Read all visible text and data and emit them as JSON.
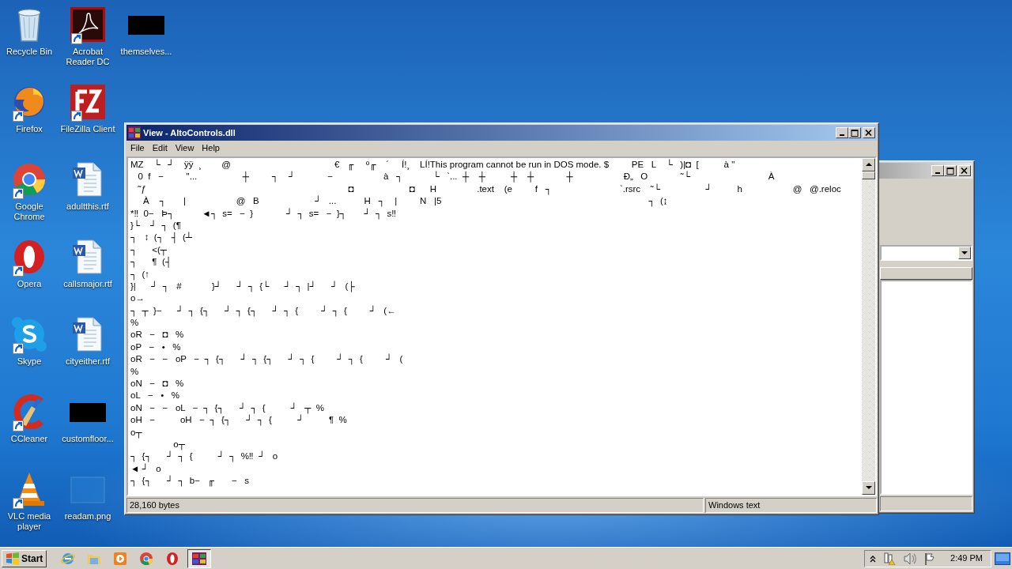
{
  "desktop_icons": [
    {
      "label": "Recycle Bin",
      "kind": "recycle",
      "shortcut": false
    },
    {
      "label": "Firefox",
      "kind": "firefox",
      "shortcut": true
    },
    {
      "label": "Google Chrome",
      "kind": "chrome",
      "shortcut": true
    },
    {
      "label": "Opera",
      "kind": "opera",
      "shortcut": true
    },
    {
      "label": "Skype",
      "kind": "skype",
      "shortcut": true
    },
    {
      "label": "CCleaner",
      "kind": "ccleaner",
      "shortcut": true
    },
    {
      "label": "VLC media player",
      "kind": "vlc",
      "shortcut": true
    },
    {
      "label": "Acrobat Reader DC",
      "kind": "acrobat",
      "shortcut": true
    },
    {
      "label": "FileZilla Client",
      "kind": "filezilla",
      "shortcut": true
    },
    {
      "label": "adultthis.rtf",
      "kind": "word",
      "shortcut": false
    },
    {
      "label": "callsmajor.rtf",
      "kind": "word",
      "shortcut": false
    },
    {
      "label": "cityeither.rtf",
      "kind": "word",
      "shortcut": false
    },
    {
      "label": "customfloor...",
      "kind": "redacted",
      "shortcut": false
    },
    {
      "label": "readam.png",
      "kind": "image",
      "shortcut": false
    },
    {
      "label": "themselves...",
      "kind": "redacted",
      "shortcut": false
    }
  ],
  "viewer_window": {
    "title": "View - AltoControls.dll",
    "menu": [
      "File",
      "Edit",
      "View",
      "Help"
    ],
    "lines": [
      "MZ    └   ┘    ÿÿ  ¸        @                                         €   ╓     º╓    ´     Í!¸    LÍ!This program cannot be run in DOS mode. $         PE   L    └   )|◘  [          à \"",
      "   0  f   −         \"...                  ┼         ┐    ┘             −                    à   ┐            └   `...  ┼    ┼          ┼    ┼             ┼                    Ð„   O             ˜└                               À",
      "   ˜ƒ                                                                                ◘                      ◘      H                .text    (e         f   ┐                           `.rsrc    ˜└                  ┘          h                    @   @.reloc",
      "     À    ┐       |                    @   B                      ┘   ...           H   ┐    |         N   |5                                                                                  ┐  (↨",
      "*‼  0−   Þ┐           ◄┐  s=   −  }             ┘  ┐  s=   −  }┐       ┘  ┐  s‼",
      "}└    ┘  ┐  (¶",
      "┐   ↕  (┐   ┤  (┴",
      "┐      <(┬",
      "┐      ¶  (┤",
      "┐  (↑",
      "}|      ┘  ┐   #            }┘      ┘  ┐  {└      ┘  ┐  |┘      ┘   (├",
      "o→",
      "┐  ┬  }−      ┘  ┐  {┐      ┘  ┐  {┐      ┘  ┐  {         ┘  ┐  {         ┘   (←",
      "%",
      "oR   −   ◘   %",
      "oP   −   •   %",
      "oR   −   −   oP   −  ┐  {┐      ┘  ┐  {┐      ┘  ┐  {         ┘  ┐  {         ┘   (",
      "%",
      "oN   −   ◘   %",
      "oL   −   •   %",
      "oN   −   −   oL   −  ┐  {┐      ┘  ┐  {          ┘   ┬  %",
      "oH   −          oH   −  ┐  {┐      ┘  ┐  {          ┘          ¶  %",
      "o┬",
      "                 o┬",
      "┐  {┐      ┘  ┐  {          ┘  ┐  %‼  ┘   o",
      "◄ ┘   o",
      "┐  {┐      ┘  ┐  b−   ╓       −   s"
    ],
    "status": [
      "28,160 bytes",
      "Windows text"
    ]
  },
  "taskbar": {
    "start": "Start",
    "quick_launch": [
      {
        "kind": "ie"
      },
      {
        "kind": "explorer"
      },
      {
        "kind": "media"
      },
      {
        "kind": "chrome"
      },
      {
        "kind": "opera"
      }
    ],
    "tasks": [
      {
        "kind": "viewer",
        "selected": true
      }
    ],
    "tray": [
      {
        "kind": "chevron"
      },
      {
        "kind": "network"
      },
      {
        "kind": "volume"
      },
      {
        "kind": "flag"
      }
    ],
    "clock": "2:49 PM"
  }
}
